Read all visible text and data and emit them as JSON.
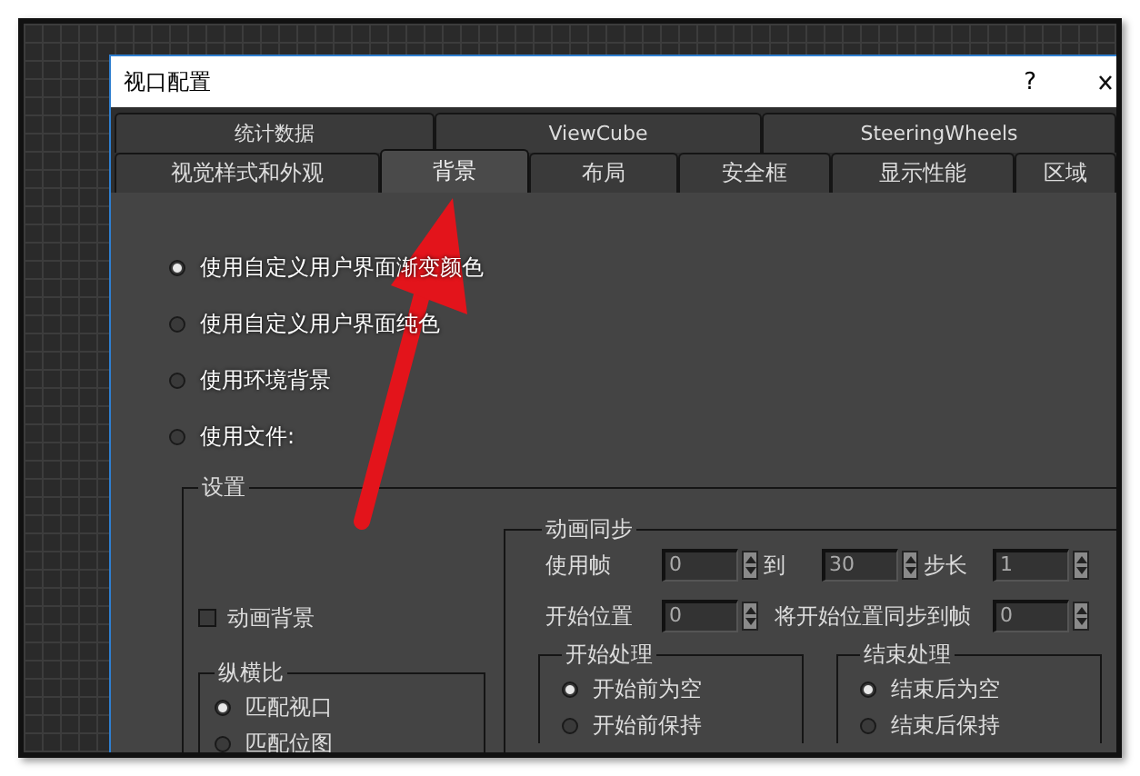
{
  "window": {
    "title": "视口配置",
    "help": "?"
  },
  "tab_rows": [
    {
      "tabs": [
        {
          "label": "统计数据",
          "selected": false
        },
        {
          "label": "ViewCube",
          "selected": false
        },
        {
          "label": "SteeringWheels",
          "selected": false
        }
      ]
    },
    {
      "tabs": [
        {
          "label": "视觉样式和外观",
          "selected": false
        },
        {
          "label": "背景",
          "selected": true
        },
        {
          "label": "布局",
          "selected": false
        },
        {
          "label": "安全框",
          "selected": false
        },
        {
          "label": "显示性能",
          "selected": false
        },
        {
          "label": "区域",
          "selected": false
        }
      ]
    }
  ],
  "background_source": [
    {
      "label": "使用自定义用户界面渐变颜色",
      "selected": true
    },
    {
      "label": "使用自定义用户界面纯色",
      "selected": false
    },
    {
      "label": "使用环境背景",
      "selected": false
    },
    {
      "label": "使用文件:",
      "selected": false
    }
  ],
  "settings": {
    "title": "设置",
    "animate_background": {
      "label": "动画背景",
      "checked": false
    },
    "aspect_ratio": {
      "title": "纵横比",
      "options": [
        {
          "label": "匹配视口",
          "selected": true
        },
        {
          "label": "匹配位图",
          "selected": false
        }
      ]
    },
    "animation_sync": {
      "title": "动画同步",
      "use_frames": {
        "label": "使用帧",
        "from": "0",
        "to_label": "到",
        "to": "30",
        "step_label": "步长",
        "step": "1"
      },
      "start_at": {
        "label": "开始位置",
        "value": "0",
        "sync_label": "将开始位置同步到帧",
        "sync_value": "0"
      },
      "start_processing": {
        "title": "开始处理",
        "options": [
          {
            "label": "开始前为空",
            "selected": true
          },
          {
            "label": "开始前保持",
            "selected": false
          }
        ]
      },
      "end_processing": {
        "title": "结束处理",
        "options": [
          {
            "label": "结束后为空",
            "selected": true
          },
          {
            "label": "结束后保持",
            "selected": false
          }
        ]
      }
    }
  }
}
